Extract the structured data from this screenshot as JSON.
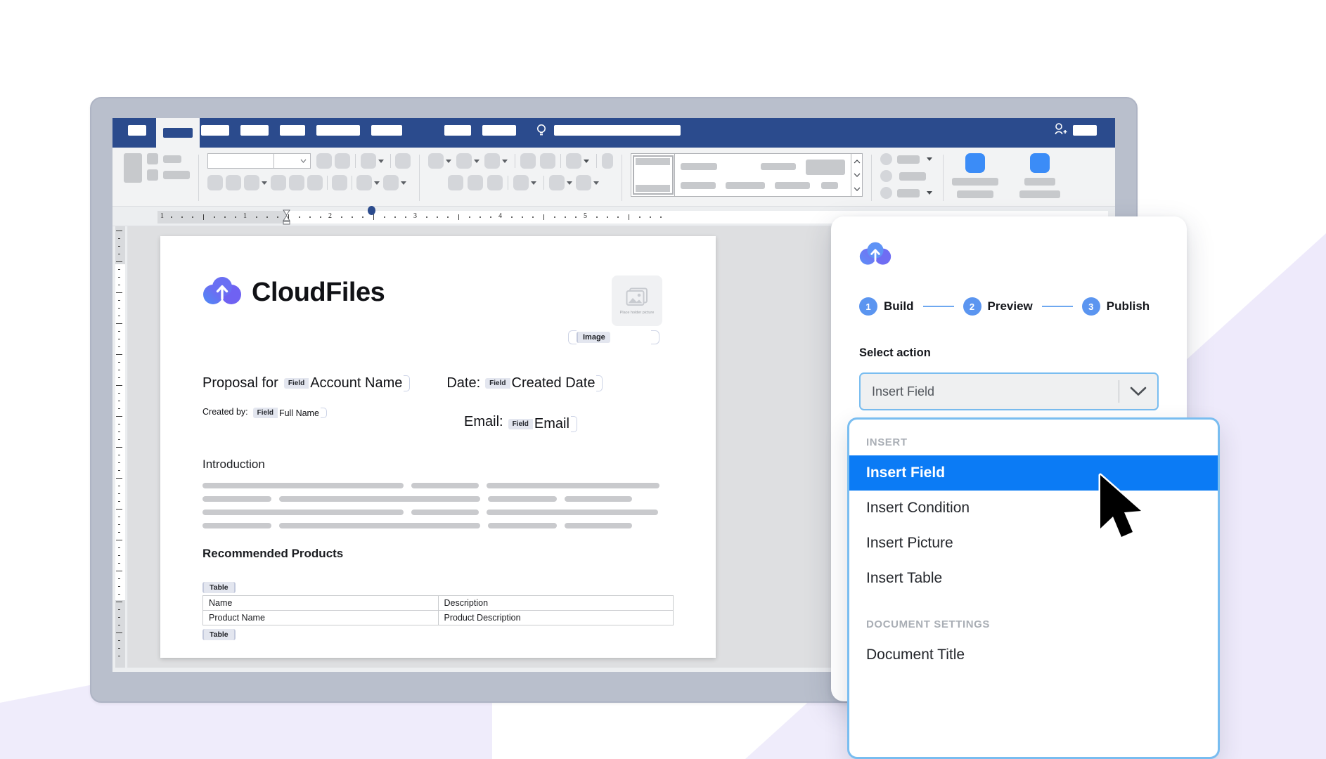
{
  "meta": {
    "scene": "Microsoft Word with CloudFiles document-builder add-in panel open",
    "accent_blue": "#0b7bf5",
    "panel_border_blue": "#79bdf0",
    "step_badge_blue": "#5b95f0",
    "word_titlebar_blue": "#2b4b8d",
    "background_lavender": "#eeebfa",
    "device_frame": "#b9bfcc"
  },
  "word": {
    "titlebar": {
      "active_tab_name": "active-ribbon-tab",
      "tab_count": 8,
      "search_icon": "lightbulb-search-icon",
      "account_icon": "person-add-icon"
    },
    "ruler": {
      "horizontal_numbers": [
        "1",
        "1",
        "2",
        "3",
        "4",
        "5"
      ],
      "indent_marker": "hourglass-indent-marker",
      "tab_stop_marker": "round-tab-stop"
    }
  },
  "document": {
    "brand_name": "CloudFiles",
    "logo": "cloudfiles-logo",
    "image_placeholder": {
      "tag": "Image",
      "caption": "Place holder picture"
    },
    "lines": [
      {
        "label": "Proposal for",
        "field_tag": "Field",
        "field_value": "Account Name",
        "size": "large"
      },
      {
        "label": "Date:",
        "field_tag": "Field",
        "field_value": "Created Date",
        "size": "large"
      },
      {
        "label": "Created by:",
        "field_tag": "Field",
        "field_value": "Full Name",
        "size": "small"
      },
      {
        "label": "Email:",
        "field_tag": "Field",
        "field_value": "Email",
        "size": "large"
      }
    ],
    "headings": {
      "introduction": "Introduction",
      "recommended_products": "Recommended Products"
    },
    "table": {
      "tag_top": "Table",
      "tag_bottom": "Table",
      "headers": [
        "Name",
        "Description"
      ],
      "rows": [
        [
          "Product Name",
          "Product Description"
        ]
      ]
    }
  },
  "panel": {
    "logo": "cloudfiles-logo",
    "steps": [
      {
        "num": "1",
        "label": "Build"
      },
      {
        "num": "2",
        "label": "Preview"
      },
      {
        "num": "3",
        "label": "Publish"
      }
    ],
    "select_label": "Select action",
    "select_value": "Insert Field"
  },
  "dropdown": {
    "groups": [
      {
        "title": "INSERT",
        "items": [
          {
            "label": "Insert Field",
            "selected": true
          },
          {
            "label": "Insert Condition",
            "selected": false
          },
          {
            "label": "Insert Picture",
            "selected": false
          },
          {
            "label": "Insert Table",
            "selected": false
          }
        ]
      },
      {
        "title": "DOCUMENT SETTINGS",
        "items": [
          {
            "label": "Document Title",
            "selected": false
          }
        ]
      }
    ]
  }
}
